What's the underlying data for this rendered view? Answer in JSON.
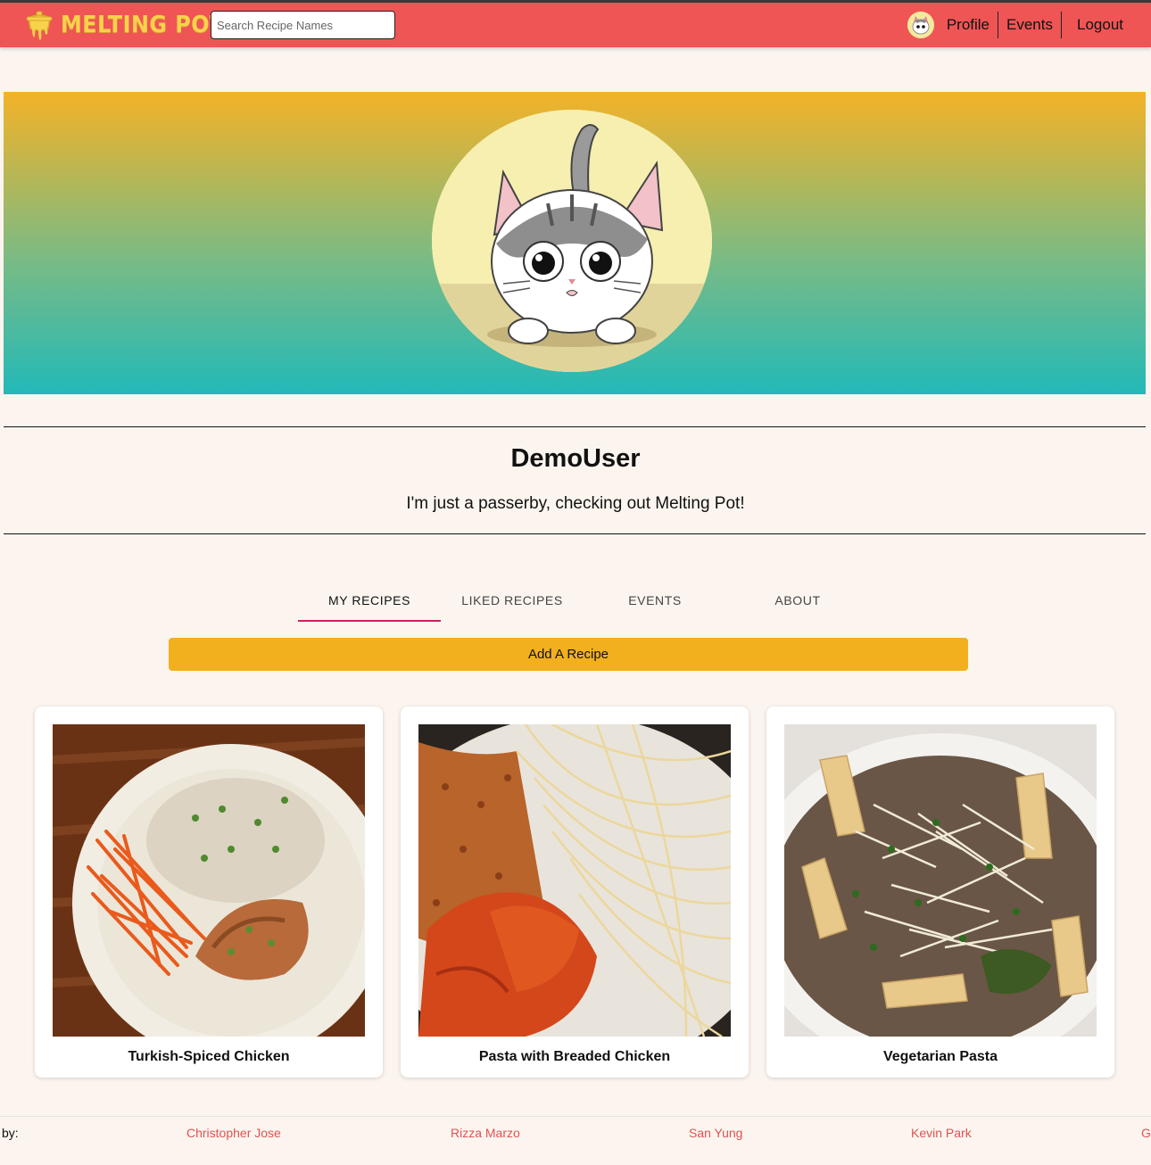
{
  "navbar": {
    "logo_text": "MELTING POT",
    "search_placeholder": "Search Recipe Names",
    "links": {
      "profile": "Profile",
      "events": "Events",
      "logout": "Logout"
    }
  },
  "profile": {
    "username": "DemoUser",
    "bio": "I'm just a passerby, checking out Melting Pot!"
  },
  "tabs": [
    {
      "label": "MY RECIPES",
      "active": true
    },
    {
      "label": "LIKED RECIPES",
      "active": false
    },
    {
      "label": "EVENTS",
      "active": false
    },
    {
      "label": "ABOUT",
      "active": false
    }
  ],
  "add_recipe_label": "Add A Recipe",
  "recipes": [
    {
      "title": "Turkish-Spiced Chicken"
    },
    {
      "title": "Pasta with Breaded Chicken"
    },
    {
      "title": "Vegetarian Pasta"
    }
  ],
  "footer": {
    "by_label": "by:",
    "credits": [
      "Christopher Jose",
      "Rizza Marzo",
      "San Yung",
      "Kevin Park",
      "G"
    ]
  },
  "colors": {
    "navbar": "#ef5555",
    "logo": "#f7d24a",
    "accent_button": "#f2b01e",
    "tab_indicator": "#d21e63",
    "banner_top": "#f4b227",
    "banner_bottom": "#22b9b8",
    "credit_link": "#e05252"
  }
}
